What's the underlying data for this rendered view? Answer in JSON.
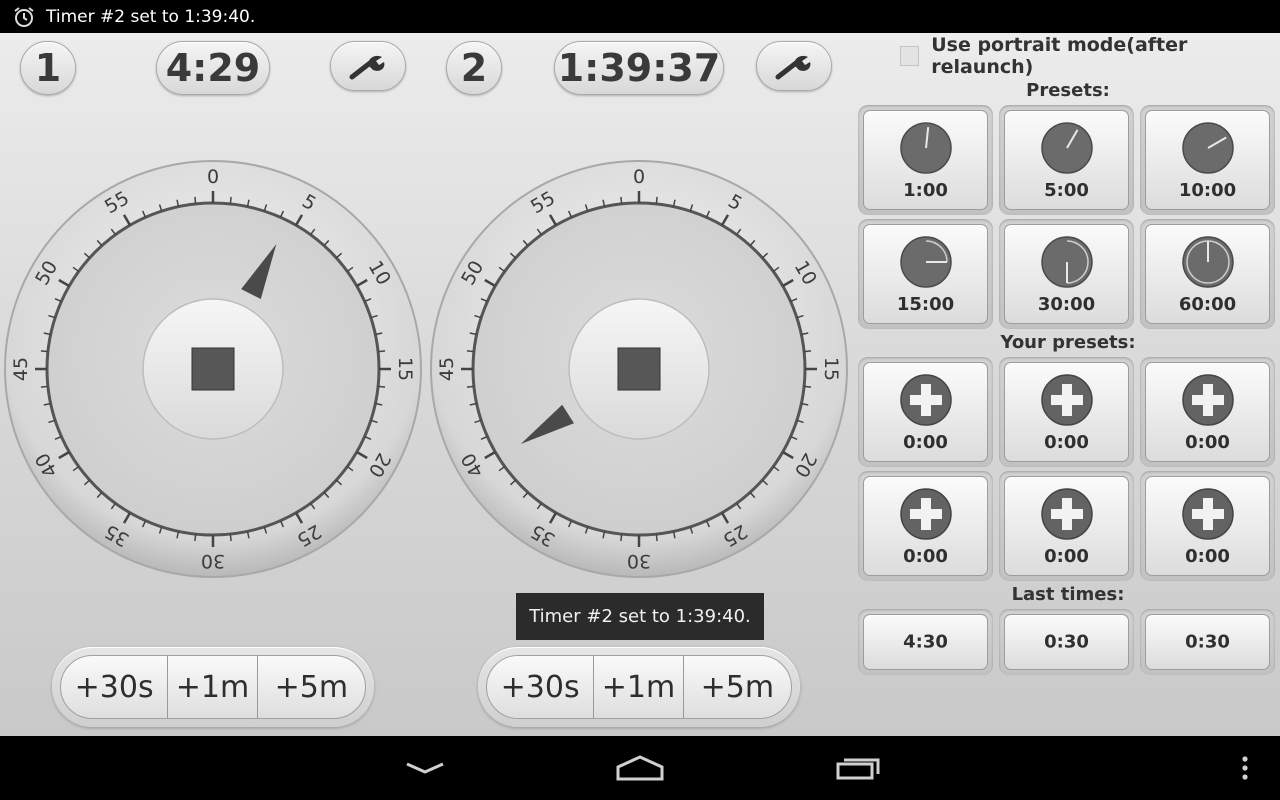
{
  "status_bar": {
    "notification_text": "Timer #2 set to 1:39:40.",
    "icon": "alarm-clock-icon"
  },
  "timers": [
    {
      "number": "1",
      "time": "4:29",
      "add_buttons": [
        "+30s",
        "+1m",
        "+5m"
      ],
      "remaining_minutes": 4.48
    },
    {
      "number": "2",
      "time": "1:39:37",
      "add_buttons": [
        "+30s",
        "+1m",
        "+5m"
      ],
      "remaining_minutes": 39.6
    }
  ],
  "dial_labels": [
    "0",
    "5",
    "10",
    "15",
    "20",
    "25",
    "30",
    "35",
    "40",
    "45",
    "50",
    "55"
  ],
  "toast": "Timer #2 set to 1:39:40.",
  "portrait_option": {
    "label": "Use portrait mode(after relaunch)",
    "checked": false
  },
  "presets": {
    "title": "Presets:",
    "items": [
      {
        "label": "1:00",
        "minutes": 1
      },
      {
        "label": "5:00",
        "minutes": 5
      },
      {
        "label": "10:00",
        "minutes": 10
      },
      {
        "label": "15:00",
        "minutes": 15
      },
      {
        "label": "30:00",
        "minutes": 30
      },
      {
        "label": "60:00",
        "minutes": 60
      }
    ]
  },
  "your_presets": {
    "title": "Your presets:",
    "items": [
      "0:00",
      "0:00",
      "0:00",
      "0:00",
      "0:00",
      "0:00"
    ]
  },
  "last_times": {
    "title": "Last times:",
    "items": [
      "4:30",
      "0:30",
      "0:30"
    ]
  },
  "colors": {
    "accent_dark": "#575757",
    "pointer": "#4a4a4a"
  }
}
